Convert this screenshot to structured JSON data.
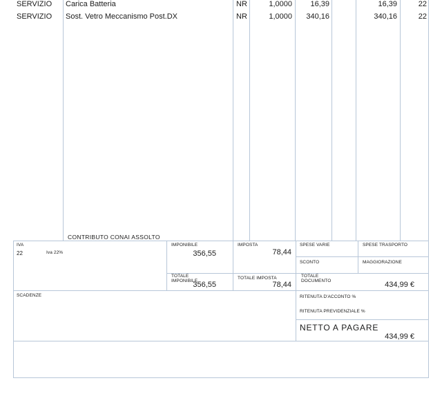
{
  "lines": [
    {
      "type": "SERVIZIO",
      "description": "Carica Batteria",
      "unit": "NR",
      "quantity": "1,0000",
      "price": "16,39",
      "amount": "16,39",
      "vat": "22"
    },
    {
      "type": "SERVIZIO",
      "description": "Sost. Vetro Meccanismo Post.DX",
      "unit": "NR",
      "quantity": "1,0000",
      "price": "340,16",
      "amount": "340,16",
      "vat": "22"
    }
  ],
  "conai_note": "CONTRIBUTO CONAI ASSOLTO",
  "summary": {
    "iva_label": "IVA",
    "iva_code": "22",
    "iva_desc": "Iva 22%",
    "imponibile_label": "IMPONIBILE",
    "imponibile_value": "356,55",
    "imposta_label": "IMPOSTA",
    "imposta_value": "78,44",
    "spese_varie_label": "SPESE VARIE",
    "spese_trasporto_label": "SPESE TRASPORTO",
    "sconto_label": "SCONTO",
    "maggiorazione_label": "MAGGIORAZIONE",
    "totale_imponibile_label_1": "TOTALE",
    "totale_imponibile_label_2": "IMPONIBILE",
    "totale_imponibile_value": "356,55",
    "totale_imposta_label": "TOTALE IMPOSTA",
    "totale_imposta_value": "78,44",
    "totale_documento_label_1": "TOTALE",
    "totale_documento_label_2": "DOCUMENTO",
    "totale_documento_value": "434,99 €"
  },
  "footer": {
    "scadenze_label": "SCADENZE",
    "ritenuta_acconto_label": "RITENUTA D'ACCONTO %",
    "ritenuta_previdenziale_label": "RITENUTA PREVIDENZIALE %",
    "netto_label": "NETTO A PAGARE",
    "netto_value": "434,99 €"
  }
}
